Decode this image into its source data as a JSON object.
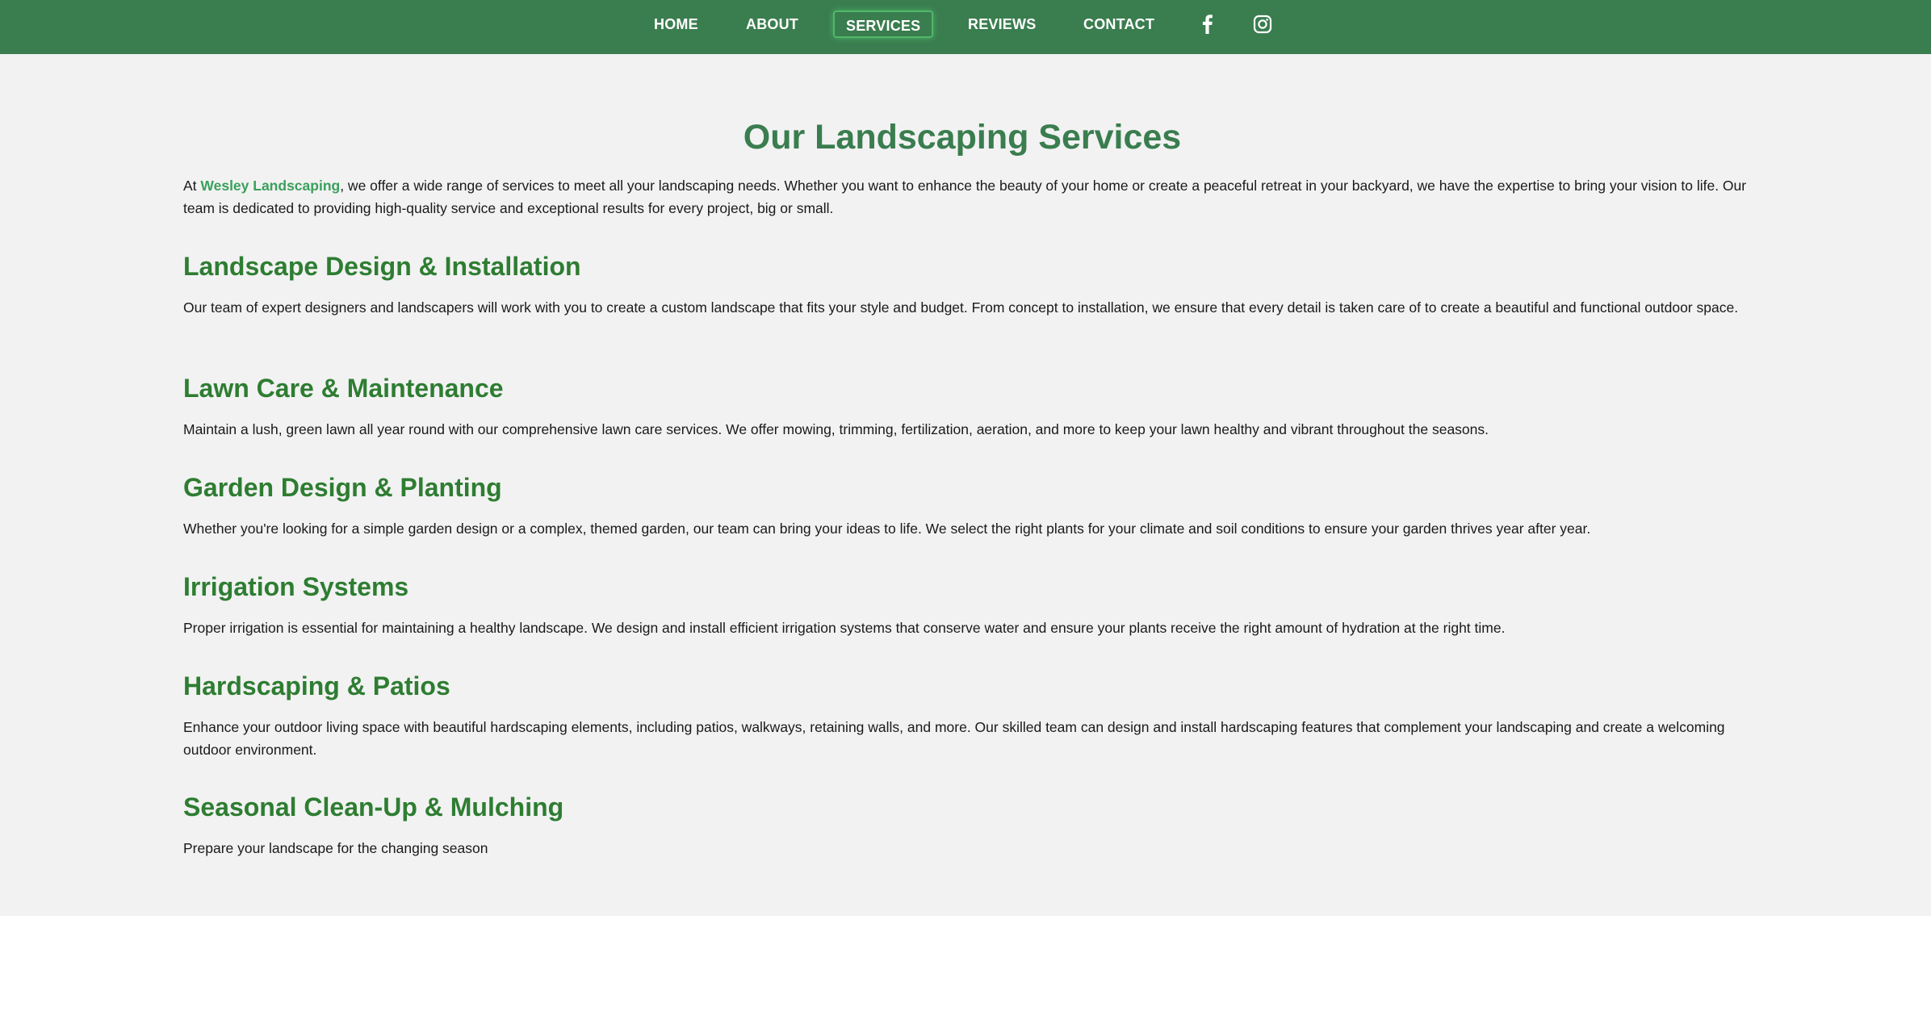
{
  "nav": {
    "items": [
      {
        "label": "HOME"
      },
      {
        "label": "ABOUT"
      },
      {
        "label": "SERVICES"
      },
      {
        "label": "REVIEWS"
      },
      {
        "label": "CONTACT"
      }
    ],
    "active": "SERVICES",
    "social": [
      "facebook-icon",
      "instagram-icon"
    ]
  },
  "colors": {
    "nav_bg": "#3a7d4f",
    "title": "#3a7d4f",
    "heading": "#2e7d32",
    "brand": "#3aa05c",
    "page_bg": "#f2f2f2"
  },
  "main": {
    "title": "Our Landscaping Services",
    "intro_prefix": "At ",
    "brand": "Wesley Landscaping",
    "intro_suffix": ", we offer a wide range of services to meet all your landscaping needs. Whether you want to enhance the beauty of your home or create a peaceful retreat in your backyard, we have the expertise to bring your vision to life. Our team is dedicated to providing high-quality service and exceptional results for every project, big or small.",
    "services": [
      {
        "title": "Landscape Design & Installation",
        "desc": "Our team of expert designers and landscapers will work with you to create a custom landscape that fits your style and budget. From concept to installation, we ensure that every detail is taken care of to create a beautiful and functional outdoor space."
      },
      {
        "title": "Lawn Care & Maintenance",
        "desc": "Maintain a lush, green lawn all year round with our comprehensive lawn care services. We offer mowing, trimming, fertilization, aeration, and more to keep your lawn healthy and vibrant throughout the seasons."
      },
      {
        "title": "Garden Design & Planting",
        "desc": "Whether you're looking for a simple garden design or a complex, themed garden, our team can bring your ideas to life. We select the right plants for your climate and soil conditions to ensure your garden thrives year after year."
      },
      {
        "title": "Irrigation Systems",
        "desc": "Proper irrigation is essential for maintaining a healthy landscape. We design and install efficient irrigation systems that conserve water and ensure your plants receive the right amount of hydration at the right time."
      },
      {
        "title": "Hardscaping & Patios",
        "desc": "Enhance your outdoor living space with beautiful hardscaping elements, including patios, walkways, retaining walls, and more. Our skilled team can design and install hardscaping features that complement your landscaping and create a welcoming outdoor environment."
      },
      {
        "title": "Seasonal Clean-Up & Mulching",
        "desc": "Prepare your landscape for the changing season"
      }
    ]
  }
}
